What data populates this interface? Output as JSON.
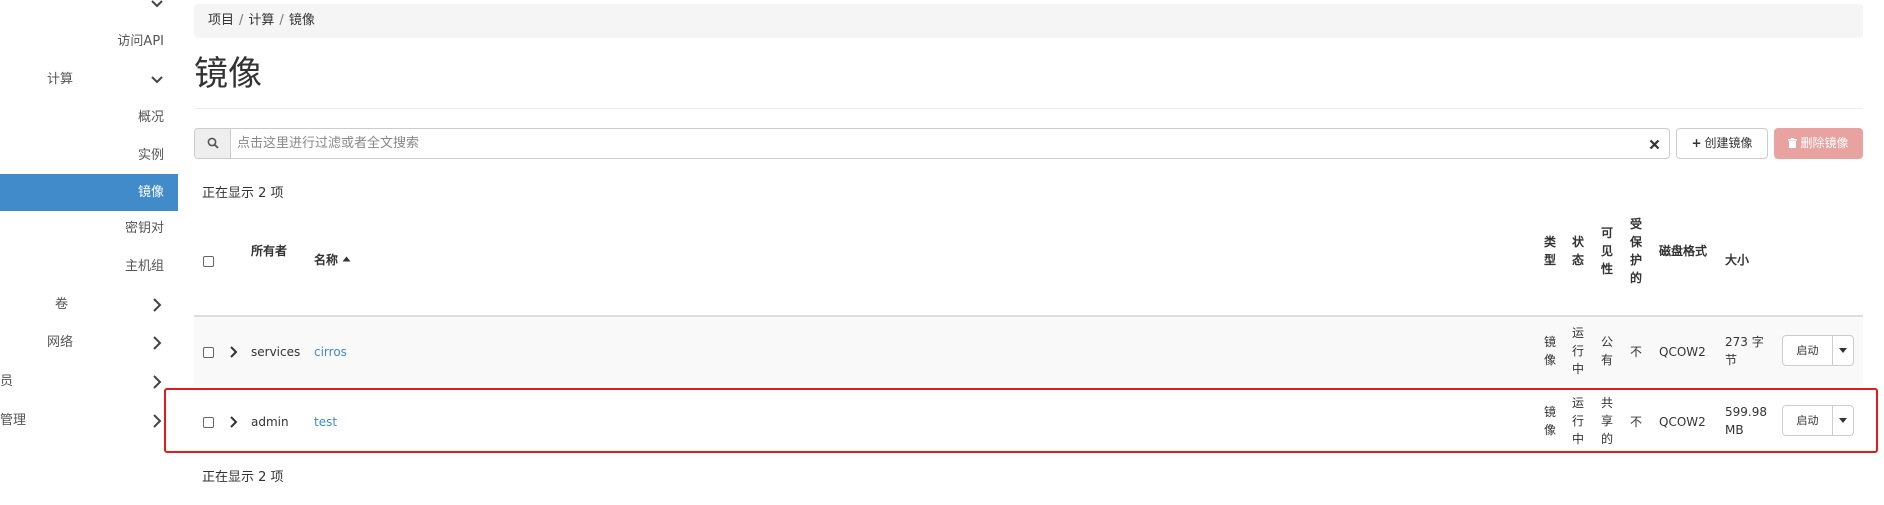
{
  "sidebar": {
    "items": [
      {
        "label": "访问API"
      },
      {
        "label": "计算"
      },
      {
        "label": "概况"
      },
      {
        "label": "实例"
      },
      {
        "label": "镜像"
      },
      {
        "label": "密钥对"
      },
      {
        "label": "主机组"
      },
      {
        "label": "卷"
      },
      {
        "label": "网络"
      },
      {
        "label": "员"
      },
      {
        "label": "管理"
      }
    ]
  },
  "breadcrumb": [
    "项目",
    "计算",
    "镜像"
  ],
  "page": {
    "title": "镜像"
  },
  "search": {
    "placeholder": "点击这里进行过滤或者全文搜索"
  },
  "actions": {
    "create_label": "创建镜像",
    "delete_label": "删除镜像"
  },
  "summary": {
    "top": "正在显示 2 项",
    "bottom": "正在显示 2 项"
  },
  "table": {
    "headers": {
      "owner": "所有者",
      "name": "名称",
      "type": "类型",
      "status": "状态",
      "visibility": "可见性",
      "protected": "受保护的",
      "disk_format": "磁盘格式",
      "size": "大小"
    },
    "rows": [
      {
        "owner": "services",
        "name": "cirros",
        "type": "镜像",
        "status": "运行中",
        "visibility": "公有",
        "protected": "不",
        "disk_format": "QCOW2",
        "size": "273 字节",
        "launch": "启动"
      },
      {
        "owner": "admin",
        "name": "test",
        "type": "镜像",
        "status": "运行中",
        "visibility": "共享的",
        "protected": "不",
        "disk_format": "QCOW2",
        "size": "599.98 MB",
        "launch": "启动"
      }
    ]
  },
  "colors": {
    "accent": "#428bca",
    "danger": "#e8a3a1",
    "highlight": "#e41a1a"
  },
  "icons": [
    "chevron-down-icon",
    "chevron-right-icon",
    "search-icon",
    "clear-icon",
    "plus-icon",
    "trash-icon",
    "sort-asc-icon",
    "caret-down-icon"
  ]
}
